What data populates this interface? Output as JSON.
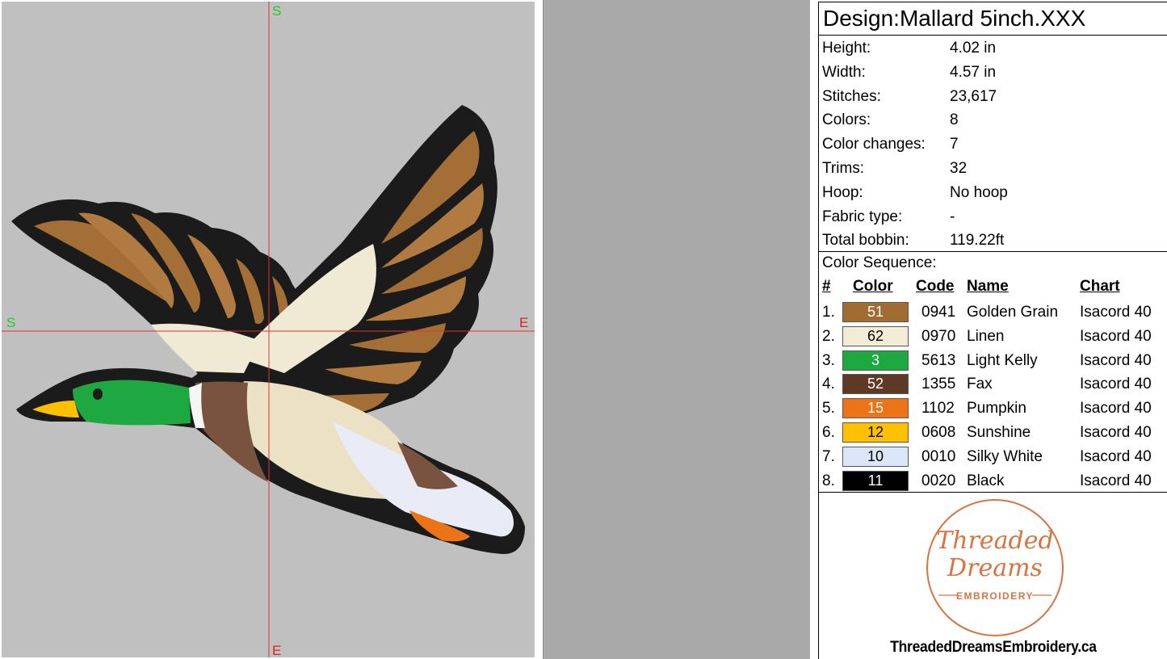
{
  "canvas": {
    "labels": {
      "top": "S",
      "left": "S",
      "right": "E",
      "bottom": "E"
    },
    "colors": {
      "background": "#c0c0c0",
      "crosshair": "#e03030",
      "start_label": "#22cc22",
      "end_label": "#dd2222"
    }
  },
  "info": {
    "title": "Design:Mallard 5inch.XXX",
    "properties": [
      {
        "label": "Height:",
        "value": "4.02 in"
      },
      {
        "label": "Width:",
        "value": "4.57 in"
      },
      {
        "label": "Stitches:",
        "value": "23,617"
      },
      {
        "label": "Colors:",
        "value": "8"
      },
      {
        "label": "Color changes:",
        "value": "7"
      },
      {
        "label": "Trims:",
        "value": "32"
      },
      {
        "label": "Hoop:",
        "value": "No hoop"
      },
      {
        "label": "Fabric type:",
        "value": "-"
      },
      {
        "label": "Total bobbin:",
        "value": "119.22ft"
      }
    ],
    "sequence_title": "Color Sequence:",
    "headers": {
      "num": "#",
      "color": "Color",
      "code": "Code",
      "name": "Name",
      "chart": "Chart"
    },
    "sequence": [
      {
        "num": "1.",
        "swatch": "51",
        "hex": "#a06c32",
        "text": "#ffffff",
        "code": "0941",
        "name": "Golden Grain",
        "chart": "Isacord 40"
      },
      {
        "num": "2.",
        "swatch": "62",
        "hex": "#f3ecd7",
        "text": "#000000",
        "code": "0970",
        "name": "Linen",
        "chart": "Isacord 40"
      },
      {
        "num": "3.",
        "swatch": "3",
        "hex": "#1ea842",
        "text": "#ffffff",
        "code": "5613",
        "name": "Light Kelly",
        "chart": "Isacord 40"
      },
      {
        "num": "4.",
        "swatch": "52",
        "hex": "#5e3a26",
        "text": "#ffffff",
        "code": "1355",
        "name": "Fax",
        "chart": "Isacord 40"
      },
      {
        "num": "5.",
        "swatch": "15",
        "hex": "#ec7418",
        "text": "#ffffff",
        "code": "1102",
        "name": "Pumpkin",
        "chart": "Isacord 40"
      },
      {
        "num": "6.",
        "swatch": "12",
        "hex": "#ffc000",
        "text": "#000000",
        "code": "0608",
        "name": "Sunshine",
        "chart": "Isacord 40"
      },
      {
        "num": "7.",
        "swatch": "10",
        "hex": "#dce6fb",
        "text": "#000000",
        "code": "0010",
        "name": "Silky White",
        "chart": "Isacord 40"
      },
      {
        "num": "8.",
        "swatch": "11",
        "hex": "#000000",
        "text": "#ffffff",
        "code": "0020",
        "name": "Black",
        "chart": "Isacord 40"
      }
    ]
  },
  "logo": {
    "line1": "Threaded",
    "line2": "Dreams",
    "line3": "EMBROIDERY",
    "color": "#d9733f"
  },
  "website": "ThreadedDreamsEmbroidery.ca"
}
